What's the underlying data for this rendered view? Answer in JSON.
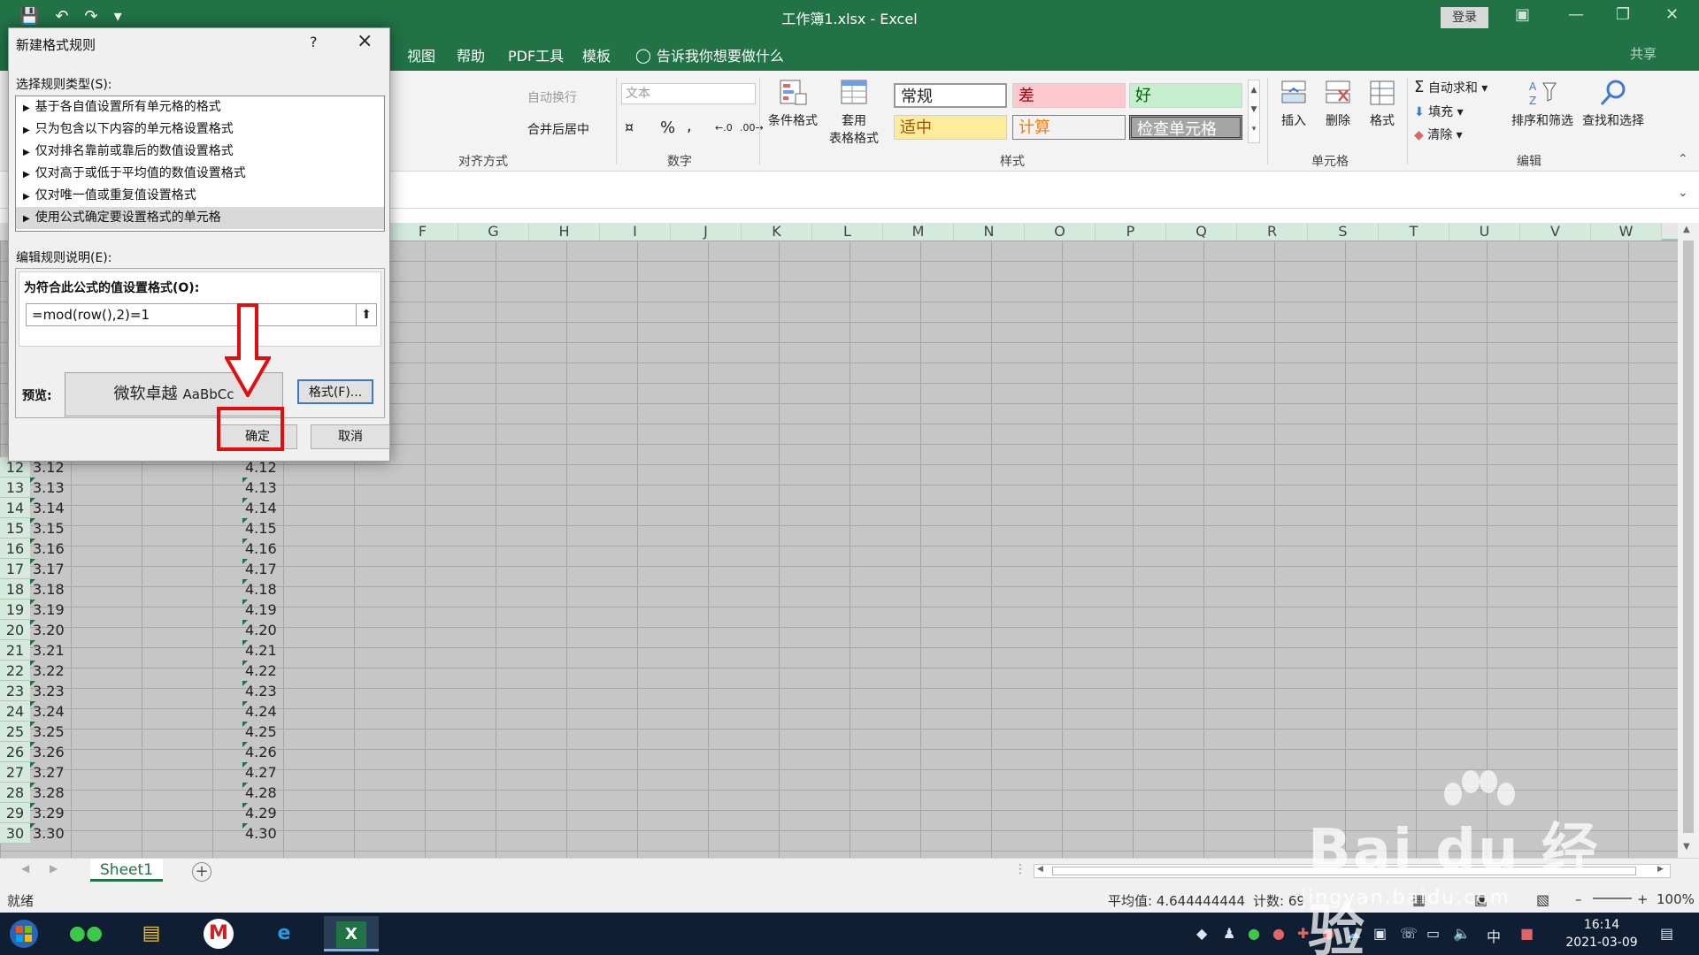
{
  "window": {
    "title": "工作簿1.xlsx  -  Excel",
    "login_label": "登录"
  },
  "tabs": [
    "视图",
    "帮助",
    "PDF工具",
    "模板"
  ],
  "tell_me": "告诉我你想要做什么",
  "share": "共享",
  "ribbon": {
    "wrap_text": "自动换行",
    "merge_center": "合并后居中",
    "align_group": "对齐方式",
    "number_format": "文本",
    "percent": "%",
    "comma": ",",
    "number_group": "数字",
    "cond_format": "条件格式",
    "table_format_1": "套用",
    "table_format_2": "表格格式",
    "styles_group": "样式",
    "styles": {
      "normal": "常规",
      "bad": "差",
      "good": "好",
      "neutral": "适中",
      "calc": "计算",
      "check": "检查单元格"
    },
    "insert": "插入",
    "delete": "删除",
    "format": "格式",
    "cells_group": "单元格",
    "autosum": "自动求和",
    "fill": "填充",
    "clear": "清除",
    "sort_filter": "排序和筛选",
    "find_select": "查找和选择",
    "edit_group": "编辑"
  },
  "columns": [
    "F",
    "G",
    "H",
    "I",
    "J",
    "K",
    "L",
    "M",
    "N",
    "O",
    "P",
    "Q",
    "R",
    "S",
    "T",
    "U",
    "V",
    "W"
  ],
  "rows": [
    {
      "n": "12",
      "a": "3.12",
      "d": "4.12"
    },
    {
      "n": "13",
      "a": "3.13",
      "d": "4.13"
    },
    {
      "n": "14",
      "a": "3.14",
      "d": "4.14"
    },
    {
      "n": "15",
      "a": "3.15",
      "d": "4.15"
    },
    {
      "n": "16",
      "a": "3.16",
      "d": "4.16"
    },
    {
      "n": "17",
      "a": "3.17",
      "d": "4.17"
    },
    {
      "n": "18",
      "a": "3.18",
      "d": "4.18"
    },
    {
      "n": "19",
      "a": "3.19",
      "d": "4.19"
    },
    {
      "n": "20",
      "a": "3.20",
      "d": "4.20"
    },
    {
      "n": "21",
      "a": "3.21",
      "d": "4.21"
    },
    {
      "n": "22",
      "a": "3.22",
      "d": "4.22"
    },
    {
      "n": "23",
      "a": "3.23",
      "d": "4.23"
    },
    {
      "n": "24",
      "a": "3.24",
      "d": "4.24"
    },
    {
      "n": "25",
      "a": "3.25",
      "d": "4.25"
    },
    {
      "n": "26",
      "a": "3.26",
      "d": "4.26"
    },
    {
      "n": "27",
      "a": "3.27",
      "d": "4.27"
    },
    {
      "n": "28",
      "a": "3.28",
      "d": "4.28"
    },
    {
      "n": "29",
      "a": "3.29",
      "d": "4.29"
    },
    {
      "n": "30",
      "a": "3.30",
      "d": "4.30"
    }
  ],
  "sheet_tab": "Sheet1",
  "status": {
    "ready": "就绪",
    "average": "平均值: 4.644444444",
    "count": "计数: 69",
    "zoom": "100%"
  },
  "taskbar": {
    "time": "16:14",
    "date": "2021-03-09",
    "ime": "中"
  },
  "dialog": {
    "title": "新建格式规则",
    "help": "?",
    "select_type_label": "选择规则类型(S):",
    "rule_types": [
      "基于各自值设置所有单元格的格式",
      "只为包含以下内容的单元格设置格式",
      "仅对排名靠前或靠后的数值设置格式",
      "仅对高于或低于平均值的数值设置格式",
      "仅对唯一值或重复值设置格式",
      "使用公式确定要设置格式的单元格"
    ],
    "edit_desc_label": "编辑规则说明(E):",
    "formula_label": "为符合此公式的值设置格式(O):",
    "formula_value": "=mod(row(),2)=1",
    "preview_label": "预览:",
    "preview_text": "微软卓越",
    "preview_sample": "AaBbCc",
    "format_button": "格式(F)...",
    "ok_button": "确定",
    "cancel_button": "取消"
  },
  "watermark": {
    "text": "Bai du 经验",
    "url": "jingyan.baidu.com"
  },
  "colors": {
    "excel_green": "#217346",
    "annotation_red": "#e20d0d",
    "style_bad_bg": "#ffc7ce",
    "style_good_bg": "#c6efce",
    "style_neutral_bg": "#ffeb9c",
    "style_check_bg": "#a5a5a5"
  }
}
